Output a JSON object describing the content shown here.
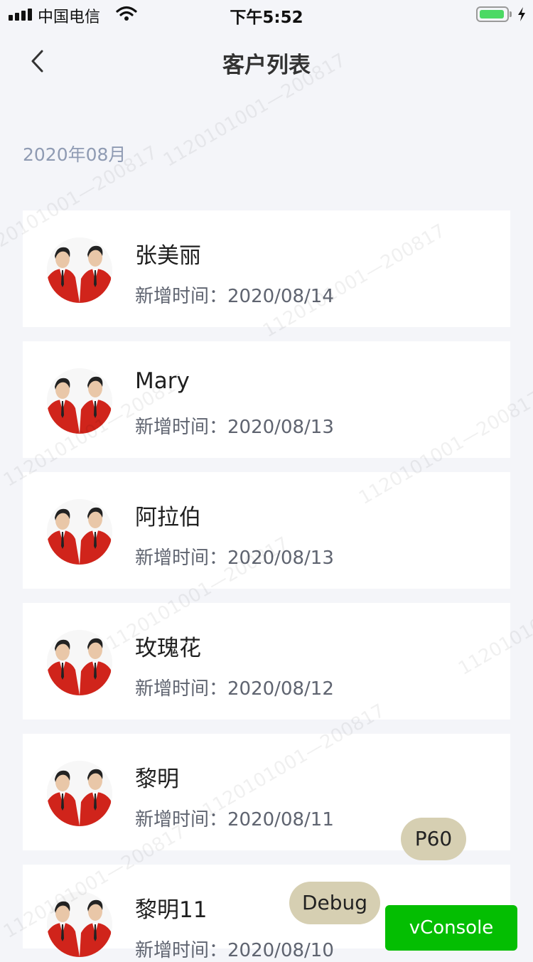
{
  "status_bar": {
    "carrier": "中国电信",
    "time": "下午5:52"
  },
  "nav": {
    "title": "客户列表"
  },
  "section": {
    "month_label": "2020年08月"
  },
  "customers": [
    {
      "name": "张美丽",
      "date_label": "新增时间：",
      "date": "2020/08/14"
    },
    {
      "name": "Mary",
      "date_label": "新增时间：",
      "date": "2020/08/13"
    },
    {
      "name": "阿拉伯",
      "date_label": "新增时间：",
      "date": "2020/08/13"
    },
    {
      "name": "玫瑰花",
      "date_label": "新增时间：",
      "date": "2020/08/12"
    },
    {
      "name": "黎明",
      "date_label": "新增时间：",
      "date": "2020/08/11"
    },
    {
      "name": "黎明11",
      "date_label": "新增时间：",
      "date": "2020/08/10"
    }
  ],
  "dev_tools": {
    "p60_label": "P60",
    "debug_label": "Debug",
    "vconsole_label": "vConsole"
  },
  "watermark": {
    "text": "1120101001—200817"
  },
  "colors": {
    "background": "#f4f5f9",
    "card": "#ffffff",
    "month_label": "#8f9bb3",
    "battery": "#4cd964",
    "vconsole": "#04be02",
    "pill": "#d6cfb2",
    "avatar_red": "#d0241b"
  },
  "icons": {
    "back": "chevron-left-icon",
    "signal": "signal-icon",
    "wifi": "wifi-icon",
    "battery": "battery-icon",
    "charging": "charging-bolt-icon",
    "avatar": "avatar-photo"
  },
  "battery_level": 0.95
}
